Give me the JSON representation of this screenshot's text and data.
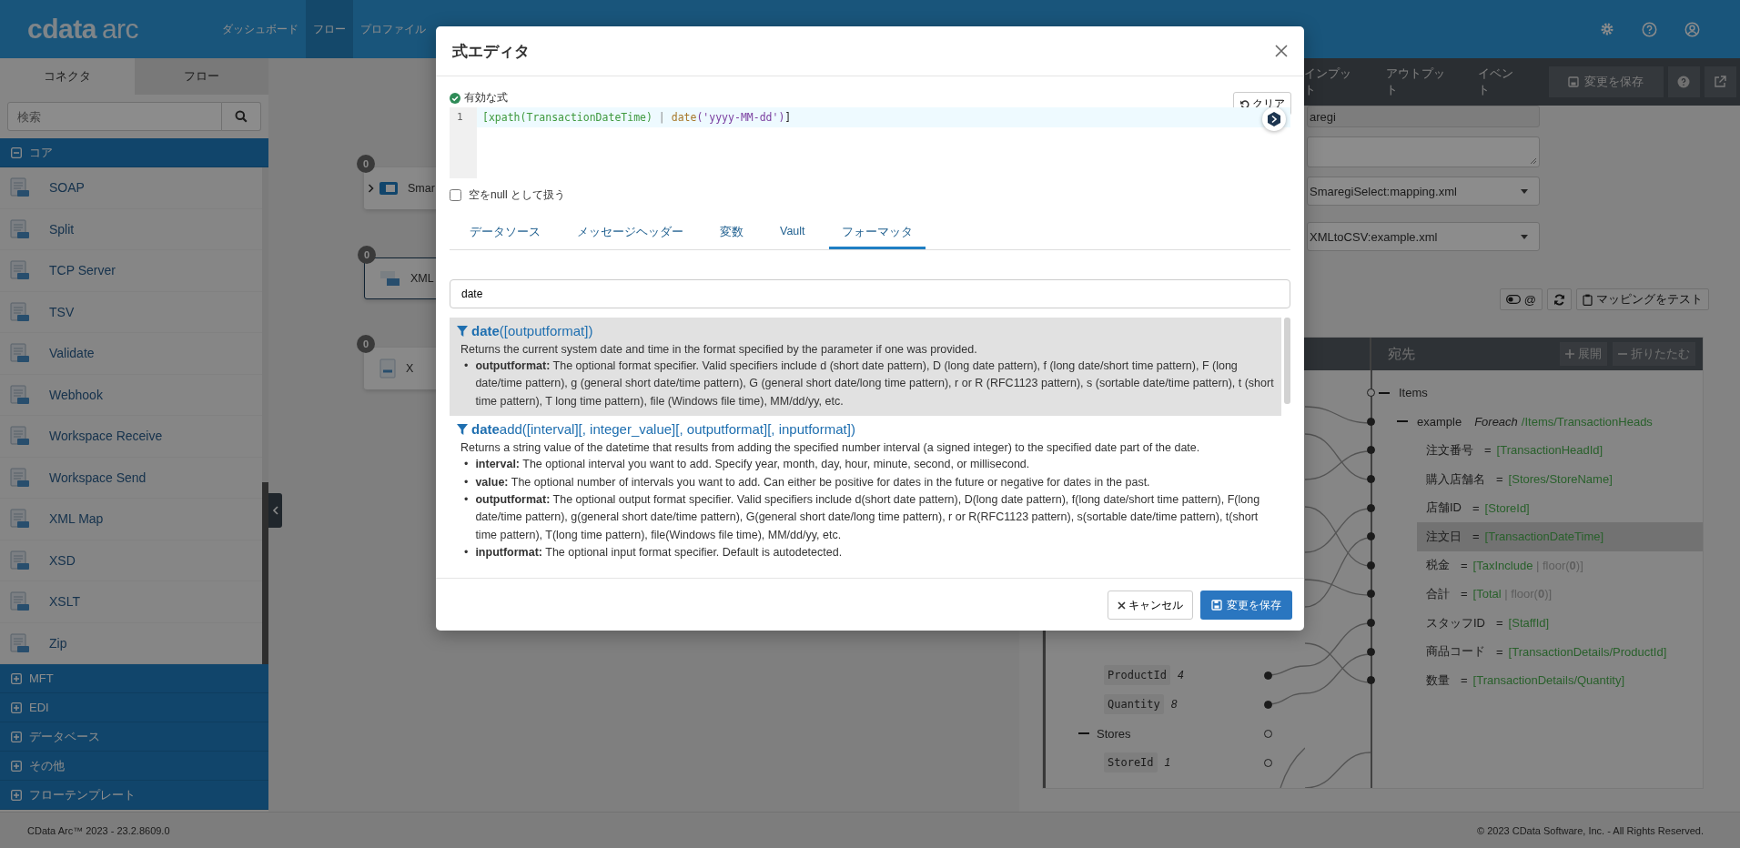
{
  "top_bar": {
    "logo": {
      "brand": "cdata",
      "product": "arc"
    },
    "nav": [
      {
        "label": "ダッシュボード",
        "selected": false
      },
      {
        "label": "フロー",
        "selected": true
      },
      {
        "label": "プロファイル",
        "selected": false
      }
    ]
  },
  "sidebar": {
    "tabs": [
      {
        "label": "コネクタ",
        "selected": true
      },
      {
        "label": "フロー",
        "selected": false
      }
    ],
    "search": {
      "placeholder": "検索"
    },
    "groups": [
      {
        "label": "コア",
        "expanded": true,
        "items": [
          "SOAP",
          "Split",
          "TCP Server",
          "TSV",
          "Validate",
          "Webhook",
          "Workspace Receive",
          "Workspace Send",
          "XML Map",
          "XSD",
          "XSLT",
          "Zip"
        ]
      },
      {
        "label": "MFT",
        "expanded": false
      },
      {
        "label": "EDI",
        "expanded": false
      },
      {
        "label": "データベース",
        "expanded": false
      },
      {
        "label": "その他",
        "expanded": false
      },
      {
        "label": "フローテンプレート",
        "expanded": false
      }
    ]
  },
  "canvas": {
    "nodes": [
      {
        "badge": "0",
        "label": "Smar",
        "kind": "api",
        "expander": true,
        "selected": false
      },
      {
        "badge": "0",
        "label": "XML",
        "kind": "map",
        "expander": false,
        "selected": true
      },
      {
        "badge": "0",
        "label": "X",
        "kind": "csv",
        "expander": false,
        "selected": false
      }
    ]
  },
  "right_panel": {
    "tabs": [
      {
        "label": "インプット",
        "selected": false
      },
      {
        "label": "アウトプット",
        "selected": false
      },
      {
        "label": "イベント",
        "selected": false
      }
    ],
    "save_button": "変更を保存",
    "fields": [
      {
        "kind": "text",
        "value": "aregi",
        "disabled": true
      },
      {
        "kind": "textarea",
        "disabled": false
      },
      {
        "kind": "select",
        "value": "SmaregiSelect:mapping.xml",
        "disabled": false
      },
      {
        "kind": "select",
        "value": "XMLtoCSV:example.xml",
        "disabled": false
      }
    ],
    "toolbar": {
      "toggle_label": "@",
      "test_button": "マッピングをテスト"
    },
    "mapping": {
      "destination_title": "宛先",
      "expand_button": "展開",
      "collapse_button": "折りたたむ",
      "source_rows": [
        {
          "kind": "field",
          "name": "ProductId",
          "index": "4",
          "connected": true
        },
        {
          "kind": "field",
          "name": "Quantity",
          "index": "8",
          "connected": true
        },
        {
          "kind": "group",
          "name": "Stores",
          "connected": false
        },
        {
          "kind": "field",
          "name": "StoreId",
          "index": "1",
          "connected": false
        }
      ],
      "destination": {
        "root": {
          "name": "Items",
          "connected": false
        },
        "element": {
          "name": "example",
          "mode": "Foreach",
          "xpath": "/Items/TransactionHeads",
          "connected": true
        },
        "fields": [
          {
            "name": "注文番号",
            "operator": "=",
            "path": "[TransactionHeadId]",
            "connected": true,
            "selected": false
          },
          {
            "name": "購入店舗名",
            "operator": "=",
            "path": "[Stores/StoreName]",
            "connected": true,
            "selected": false
          },
          {
            "name": "店舗ID",
            "operator": "=",
            "path": "[StoreId]",
            "connected": true,
            "selected": false
          },
          {
            "name": "注文日",
            "operator": "=",
            "path": "[TransactionDateTime]",
            "connected": true,
            "selected": true
          },
          {
            "name": "税金",
            "operator": "=",
            "path": "[TaxInclude",
            "formatter": " | floor(**0**)]",
            "connected": true,
            "selected": false
          },
          {
            "name": "合計",
            "operator": "=",
            "path": "[Total",
            "formatter": " | floor(**0**)]",
            "connected": true,
            "selected": false
          },
          {
            "name": "スタッフID",
            "operator": "=",
            "path": "[StaffId]",
            "connected": true,
            "selected": false
          },
          {
            "name": "商品コード",
            "operator": "=",
            "path": "[TransactionDetails/ProductId]",
            "connected": true,
            "selected": false
          },
          {
            "name": "数量",
            "operator": "=",
            "path": "[TransactionDetails/Quantity]",
            "connected": true,
            "selected": false
          }
        ]
      }
    }
  },
  "footer": {
    "version": "CData Arc™ 2023 - 23.2.8609.0",
    "copyright": "© 2023 CData Software, Inc. - All Rights Reserved."
  },
  "modal": {
    "title": "式エディタ",
    "status": {
      "label": "有効な式",
      "valid": true
    },
    "clear_button": "クリア",
    "editor": {
      "line_numbers": [
        "1"
      ],
      "tokens": [
        {
          "text": "[xpath(TransactionDateTime)",
          "kind": "xpath"
        },
        {
          "text": " | ",
          "kind": "pipe"
        },
        {
          "text": "date",
          "kind": "formatter"
        },
        {
          "text": "('yyyy-MM-dd')",
          "kind": "string"
        },
        {
          "text": "]",
          "kind": "punct"
        }
      ]
    },
    "null_option": {
      "label": "空をnull として扱う",
      "checked": false
    },
    "tabs": [
      {
        "label": "データソース",
        "selected": false
      },
      {
        "label": "メッセージヘッダー",
        "selected": false
      },
      {
        "label": "変数",
        "selected": false
      },
      {
        "label": "Vault",
        "selected": false
      },
      {
        "label": "フォーマッタ",
        "selected": true
      }
    ],
    "search": {
      "value": "date"
    },
    "functions": [
      {
        "marker": "•",
        "title": "**date**([outputformat])",
        "description": "Returns the current system date and time in the format specified by the parameter if one was provided.",
        "params": [
          "**outputformat:** The optional format specifier. Valid specifiers include d (short date pattern), D (long date pattern), f (long date/short time pattern), F (long date/time pattern), g (general short date/time pattern), G (general short date/long time pattern), r or R (RFC1123 pattern), s (sortable date/time pattern), t (short time pattern), T long time pattern), file (Windows file time), MM/dd/yy, etc."
        ],
        "selected": true
      },
      {
        "marker": "•",
        "title": "**date**add([interval][, integer_value][, outputformat][, inputformat])",
        "description": "Returns a string value of the datetime that results from adding the specified number interval (a signed integer) to the specified date part of the date.",
        "params": [
          "**interval:** The optional interval you want to add. Specify year, month, day, hour, minute, second, or millisecond.",
          "**value:** The optional number of intervals you want to add. Can either be positive for dates in the future or negative for dates in the past.",
          "**outputformat:** The optional output format specifier. Valid specifiers include d(short date pattern), D(long date pattern), f(long date/short time pattern), F(long date/time pattern), g(general short date/time pattern), G(general short date/long time pattern), r or R(RFC1123 pattern), s(sortable date/time pattern), t(short time pattern), T(long time pattern), file(Windows file time), MM/dd/yy, etc.",
          "**inputformat:** The optional input format specifier. Default is autodetected."
        ],
        "selected": false
      }
    ],
    "buttons": {
      "cancel": "キャンセル",
      "save": "変更を保存"
    }
  }
}
